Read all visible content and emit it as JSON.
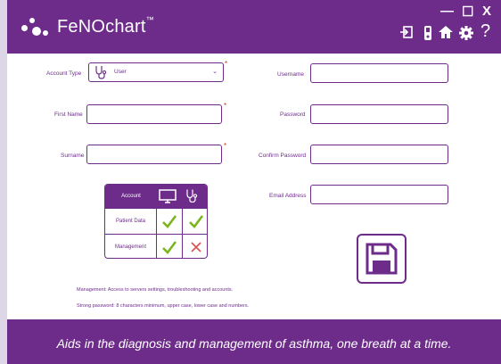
{
  "app": {
    "title": "FeNOchart",
    "trademark": "™"
  },
  "window": {
    "minimize": "—",
    "maximize": "☐",
    "close": "X"
  },
  "toolbar": {
    "help": "?"
  },
  "form": {
    "account_type": {
      "label": "Account Type",
      "value": "User",
      "required": "*"
    },
    "first_name": {
      "label": "First Name",
      "value": "",
      "required": "*"
    },
    "surname": {
      "label": "Surname",
      "value": "",
      "required": "*"
    },
    "username": {
      "label": "Username",
      "value": ""
    },
    "password": {
      "label": "Password",
      "value": ""
    },
    "confirm_password": {
      "label": "Confirm Password",
      "value": ""
    },
    "email": {
      "label": "Email Address",
      "value": ""
    }
  },
  "permissions": {
    "header": "Account",
    "columns": [
      "computer-icon",
      "stethoscope-icon"
    ],
    "rows": [
      {
        "label": "Patient Data",
        "computer": "check",
        "stethoscope": "check"
      },
      {
        "label": "Management",
        "computer": "check",
        "stethoscope": "cross"
      }
    ]
  },
  "notes": {
    "management": "Management: Access to servers settings, troubleshooting and accounts.",
    "password": "Strong password: 8 characters minimum, upper case, lower case and numbers."
  },
  "footer": {
    "tagline": "Aids in the diagnosis and management of asthma, one breath at a time."
  },
  "colors": {
    "brand": "#6d2c8a",
    "check": "#7ab51d",
    "cross": "#d9534f",
    "required": "#c0392b"
  }
}
